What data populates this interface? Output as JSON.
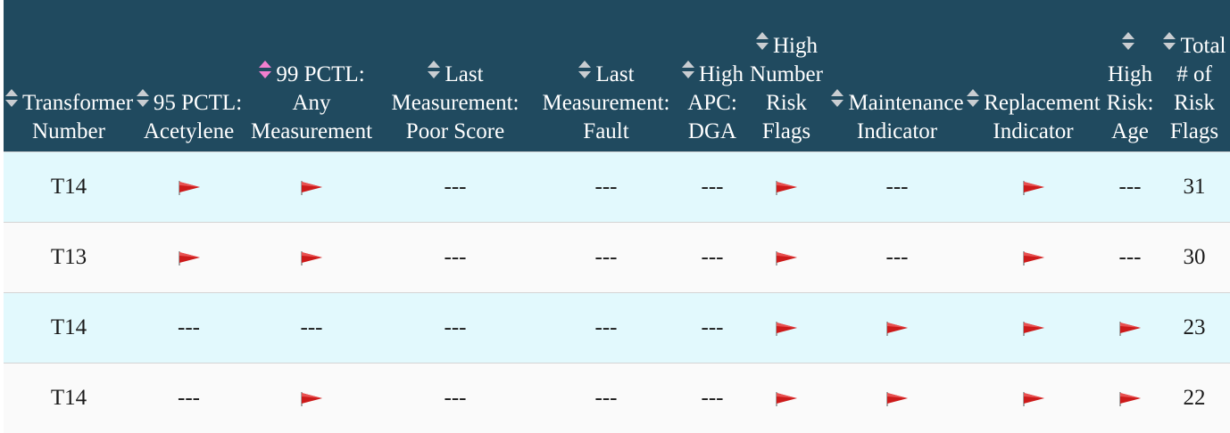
{
  "colors": {
    "header_bg": "#204a5f",
    "header_text": "#ffffff",
    "sort_icon_default": "#c9cdd1",
    "sort_icon_active": "#f27fcf",
    "row_alt_bg": "#e2f9fd",
    "row_bg": "#fafafa",
    "flag": "#cc1a1a"
  },
  "table": {
    "columns": [
      {
        "key": "transformer",
        "label": "Transformer Number",
        "sort": "none"
      },
      {
        "key": "p95_acetylene",
        "label": "95 PCTL: Acetylene",
        "sort": "none"
      },
      {
        "key": "p99_any",
        "label": "99 PCTL: Any Measurement",
        "sort": "active"
      },
      {
        "key": "last_poor",
        "label": "Last Measurement: Poor Score",
        "sort": "none"
      },
      {
        "key": "last_fault",
        "label": "Last Measurement: Fault",
        "sort": "none"
      },
      {
        "key": "high_apc",
        "label": "High APC: DGA",
        "sort": "none"
      },
      {
        "key": "high_number",
        "label": "High Number Risk Flags",
        "sort": "none"
      },
      {
        "key": "maintenance",
        "label": "Maintenance Indicator",
        "sort": "none"
      },
      {
        "key": "replacement",
        "label": "Replacement Indicator",
        "sort": "none"
      },
      {
        "key": "high_age",
        "label": "High Risk: Age",
        "sort": "none"
      },
      {
        "key": "total",
        "label": "Total # of Risk Flags",
        "sort": "none"
      }
    ],
    "empty_marker": "---",
    "flag_icon": "red-flag-icon",
    "rows": [
      {
        "transformer": "T14",
        "cells": [
          "flag",
          "flag",
          "---",
          "---",
          "---",
          "flag",
          "---",
          "flag",
          "---"
        ],
        "total": "31"
      },
      {
        "transformer": "T13",
        "cells": [
          "flag",
          "flag",
          "---",
          "---",
          "---",
          "flag",
          "---",
          "flag",
          "---"
        ],
        "total": "30"
      },
      {
        "transformer": "T14",
        "cells": [
          "---",
          "---",
          "---",
          "---",
          "---",
          "flag",
          "flag",
          "flag",
          "flag"
        ],
        "total": "23"
      },
      {
        "transformer": "T14",
        "cells": [
          "---",
          "flag",
          "---",
          "---",
          "---",
          "flag",
          "flag",
          "flag",
          "flag"
        ],
        "total": "22"
      }
    ]
  }
}
